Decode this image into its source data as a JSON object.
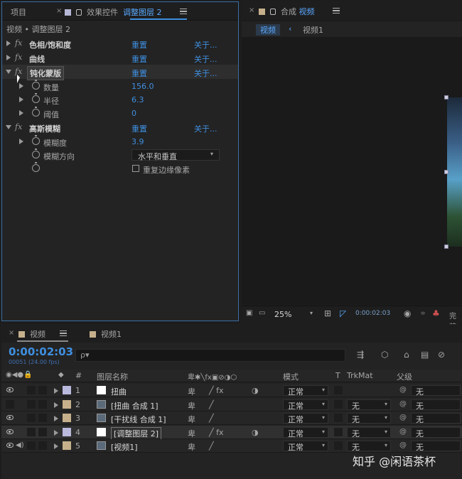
{
  "effect_panel": {
    "tab_project": "项目",
    "tab_effect_controls": "效果控件",
    "tab_layer_name": "调整图层 2",
    "breadcrumb": "视频 • 调整图层 2",
    "effects": [
      {
        "name": "色相/饱和度",
        "reset": "重置",
        "about": "关于..."
      },
      {
        "name": "曲线",
        "reset": "重置",
        "about": "关于..."
      },
      {
        "name": "钝化蒙版",
        "reset": "重置",
        "about": "关于..."
      },
      {
        "name": "高斯模糊",
        "reset": "重置",
        "about": "关于..."
      }
    ],
    "unsharp_params": [
      {
        "label": "数量",
        "value": "156.0"
      },
      {
        "label": "半径",
        "value": "6.3"
      },
      {
        "label": "阈值",
        "value": "0"
      }
    ],
    "blur_params": {
      "blurriness_label": "模糊度",
      "blurriness_value": "3.9",
      "direction_label": "模糊方向",
      "direction_value": "水平和垂直",
      "repeat_edge_label": "重复边缘像素"
    }
  },
  "comp_panel": {
    "tab_prefix": "合成",
    "tab_name": "视频",
    "crumb_active": "视频",
    "crumb_other": "视频1",
    "zoom": "25%",
    "timecode": "0:00:02:03",
    "full_label": "完整"
  },
  "timeline": {
    "tab_active": "视频",
    "tab_other": "视频1",
    "timecode": "0:00:02:03",
    "fps": "00051 (24.00 fps)",
    "search_placeholder": "ρ▾",
    "headers": {
      "hash": "#",
      "layer_name": "图层名称",
      "mode": "模式",
      "t": "T",
      "trkmat": "TrkMat",
      "parent": "父级"
    },
    "rows": [
      {
        "num": "1",
        "name": "扭曲",
        "mode": "正常",
        "trkmat": "",
        "parent": "无",
        "color": "#b9b9de",
        "thumb": "white"
      },
      {
        "num": "2",
        "name": "[扭曲 合成 1]",
        "mode": "正常",
        "trkmat": "无",
        "parent": "无",
        "color": "#c6b08c",
        "thumb": "comp"
      },
      {
        "num": "3",
        "name": "[干扰线 合成 1]",
        "mode": "正常",
        "trkmat": "无",
        "parent": "无",
        "color": "#c6b08c",
        "thumb": "comp"
      },
      {
        "num": "4",
        "name": "[调整图层 2]",
        "mode": "正常",
        "trkmat": "无",
        "parent": "无",
        "color": "#b9b9de",
        "thumb": "white"
      },
      {
        "num": "5",
        "name": "[视频1]",
        "mode": "正常",
        "trkmat": "无",
        "parent": "无",
        "color": "#c6b08c",
        "thumb": "comp"
      }
    ]
  },
  "watermark": "知乎 @闲语茶杯",
  "colors": {
    "accent_blue": "#3f8fe0",
    "panel_bg": "#232323",
    "label_lavender": "#b9b9de",
    "label_sand": "#c6b08c"
  }
}
